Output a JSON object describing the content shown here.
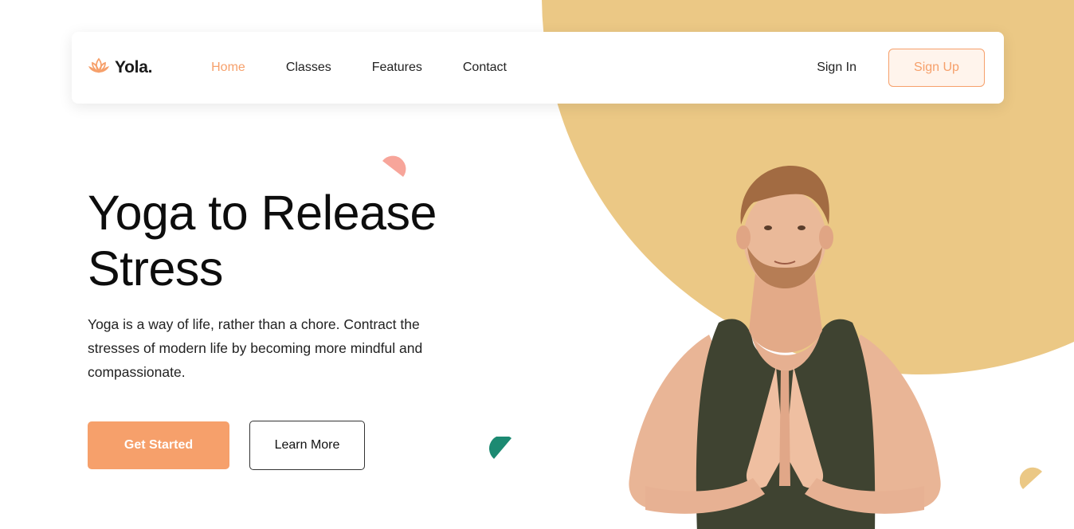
{
  "brand": {
    "name": "Yola.",
    "logo_icon": "lotus-icon"
  },
  "nav": {
    "links": [
      "Home",
      "Classes",
      "Features",
      "Contact"
    ],
    "active_index": 0,
    "sign_in": "Sign In",
    "sign_up": "Sign Up"
  },
  "hero": {
    "title_line1": "Yoga to Release",
    "title_line2": "Stress",
    "description": "Yoga is a way of life, rather than a chore. Contract the stresses of modern life by becoming more mindful and compassionate.",
    "cta_primary": "Get Started",
    "cta_secondary": "Learn More"
  },
  "colors": {
    "accent": "#f6a06b",
    "circle": "#ebc885",
    "deco_pink": "#f7a59a",
    "deco_green": "#1c8a72",
    "deco_yellow": "#ebc885"
  }
}
